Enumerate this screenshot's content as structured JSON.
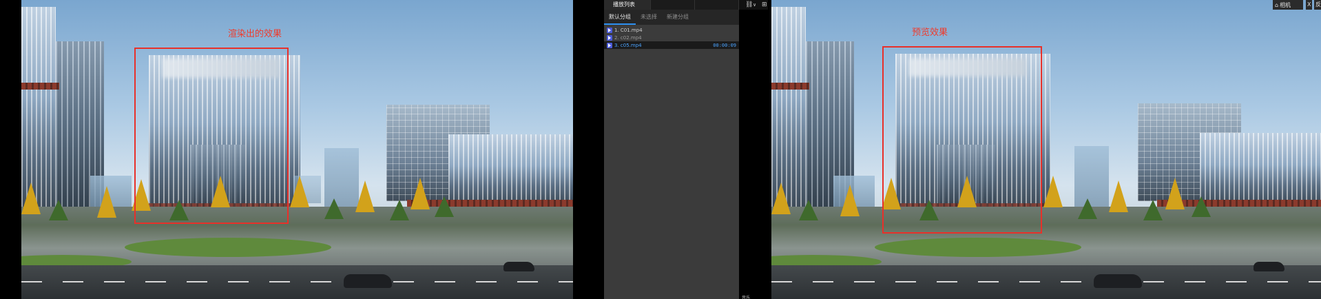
{
  "left_view": {
    "annotation": "渲染出的效果"
  },
  "right_view": {
    "annotation": "预览效果"
  },
  "playlist": {
    "header_tab": "播放列表",
    "tabs": [
      "默认分组",
      "未选择",
      "新建分组"
    ],
    "items": [
      {
        "name": "1. C01.mp4",
        "duration": ""
      },
      {
        "name": "2. c02.mp4",
        "duration": ""
      },
      {
        "name": "3. c05.mp4",
        "duration": "00:00:09"
      }
    ],
    "selected_index": 2
  },
  "toolbar": {
    "link_glyph": "⛓",
    "chevron_glyph": "∨",
    "grid_glyph": "⊞",
    "camera_label": "相机",
    "close_glyph": "X",
    "edge_label": "反"
  },
  "footer": {
    "label": "音乐"
  }
}
